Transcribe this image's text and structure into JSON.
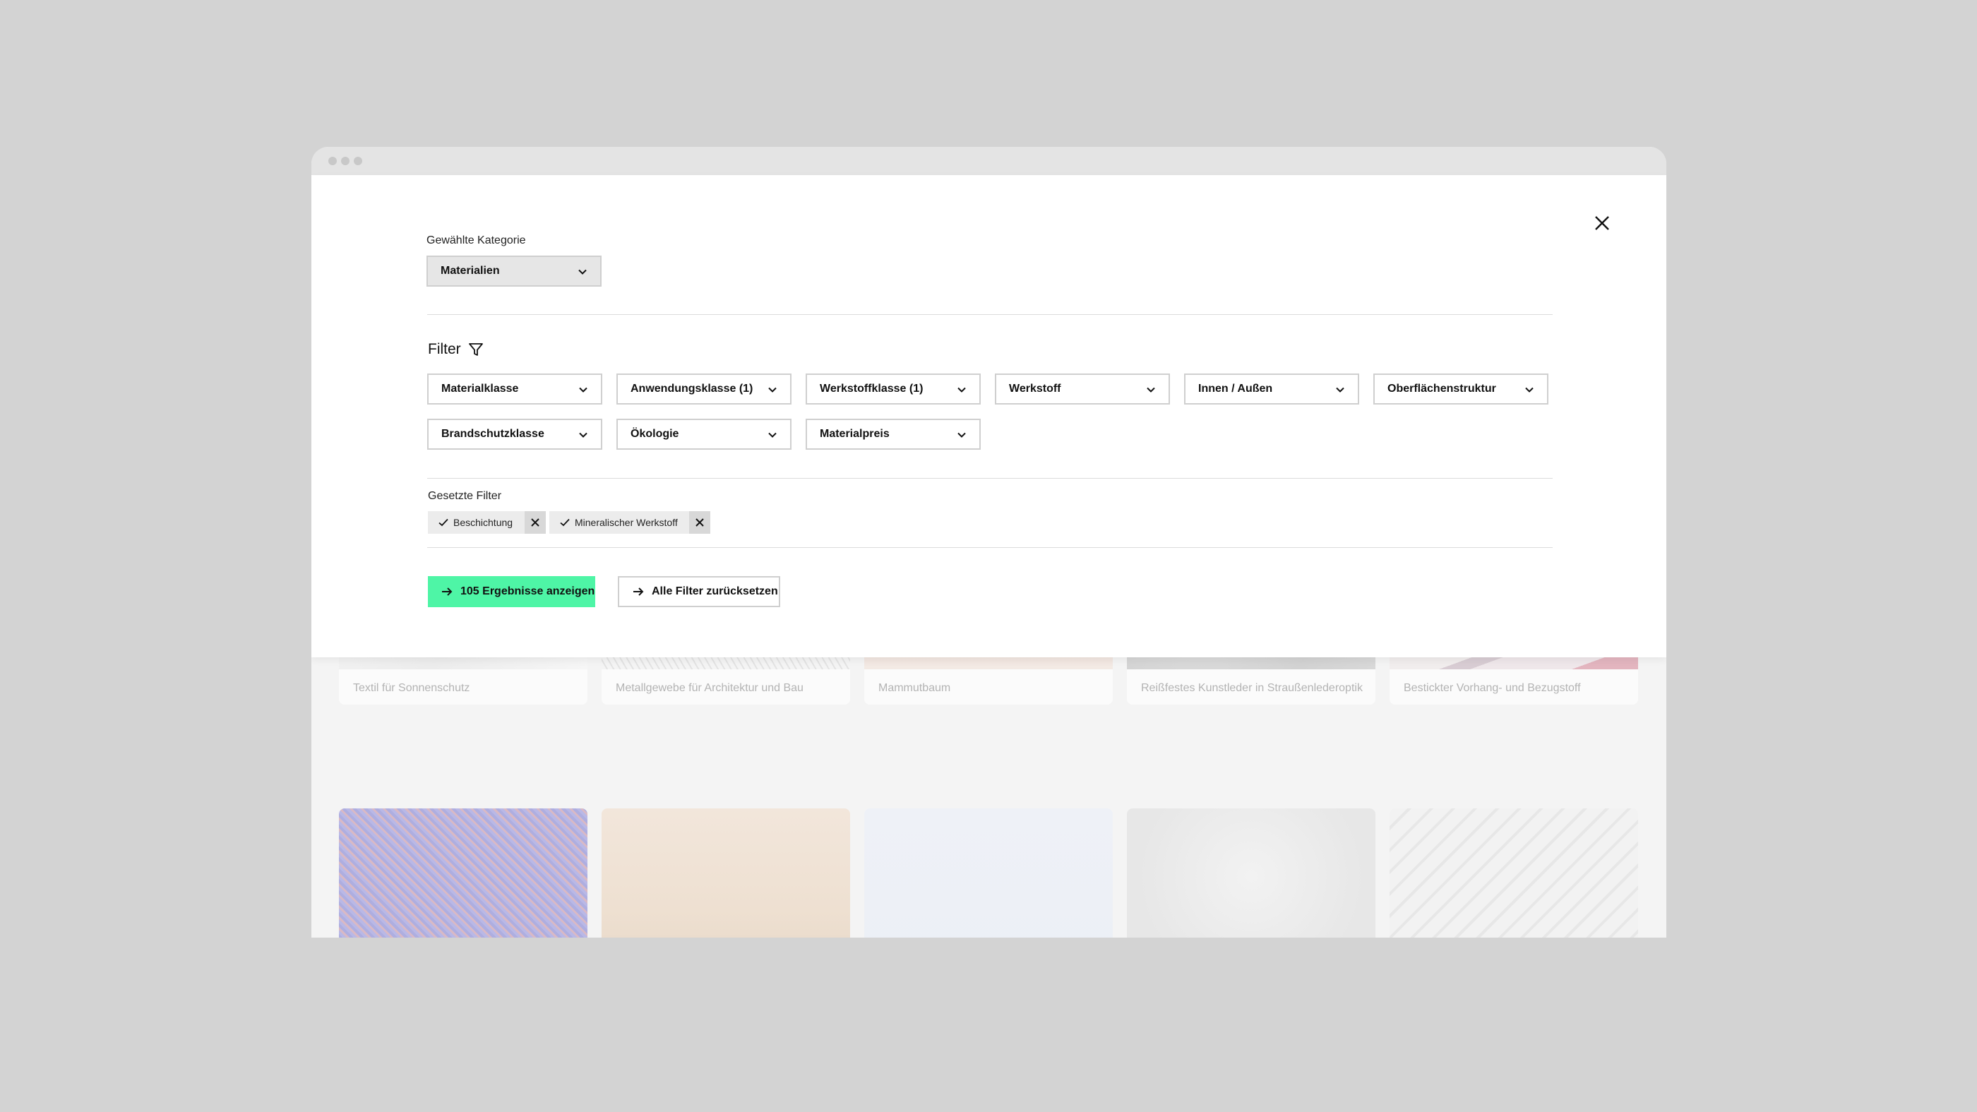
{
  "modal": {
    "category_label": "Gewählte Kategorie",
    "category_value": "Materialien",
    "filter_title": "Filter",
    "filters": [
      "Materialklasse",
      "Anwendungsklasse (1)",
      "Werkstoffklasse (1)",
      "Werkstoff",
      "Innen / Außen",
      "Oberflächenstruktur",
      "Brandschutzklasse",
      "Ökologie",
      "Materialpreis"
    ],
    "set_filters_label": "Gesetzte Filter",
    "chips": [
      "Beschichtung",
      "Mineralischer Werkstoff"
    ],
    "primary_button": "105 Ergebnisse anzeigen",
    "secondary_button": "Alle Filter zurücksetzen"
  },
  "cards_row1": [
    "Textil für Sonnenschutz",
    "Metallgewebe für Architektur und Bau",
    "Mammutbaum",
    "Reißfestes Kunstleder in Straußenlederoptik",
    "Bestickter Vorhang- und Bezugstoff"
  ],
  "colors": {
    "page_background": "#d3d3d3",
    "primary_button": "#4ef5a6",
    "chip_background": "#ececec"
  }
}
